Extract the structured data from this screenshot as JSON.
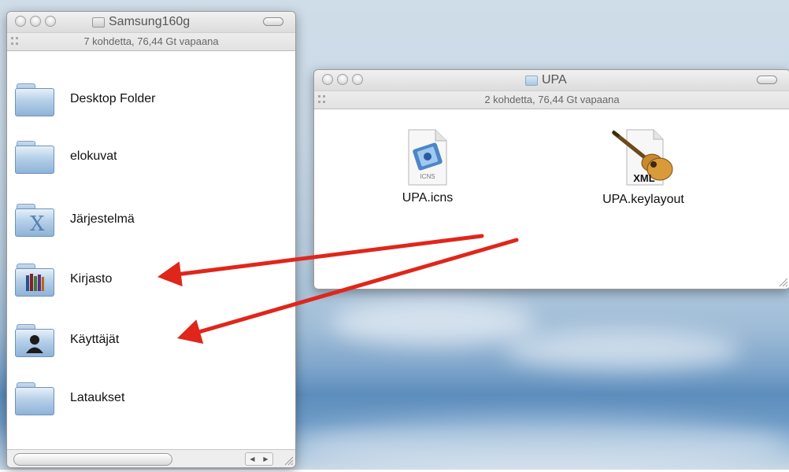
{
  "finder_left": {
    "title": "Samsung160g",
    "status": "7 kohdetta, 76,44 Gt vapaana",
    "items": [
      {
        "label": "Desktop Folder",
        "icon": "folder-icon"
      },
      {
        "label": "elokuvat",
        "icon": "folder-icon"
      },
      {
        "label": "Järjestelmä",
        "icon": "system-folder-icon"
      },
      {
        "label": "Kirjasto",
        "icon": "library-folder-icon"
      },
      {
        "label": "Käyttäjät",
        "icon": "users-folder-icon"
      },
      {
        "label": "Lataukset",
        "icon": "folder-icon"
      }
    ]
  },
  "finder_right": {
    "title": "UPA",
    "status": "2 kohdetta, 76,44 Gt vapaana",
    "files": [
      {
        "label": "UPA.icns",
        "icon": "icns-file-icon",
        "badge": "ICNS"
      },
      {
        "label": "UPA.keylayout",
        "icon": "xml-keylayout-icon",
        "badge": "XML"
      }
    ]
  },
  "annotations": {
    "arrow_color": "#e0261b"
  }
}
